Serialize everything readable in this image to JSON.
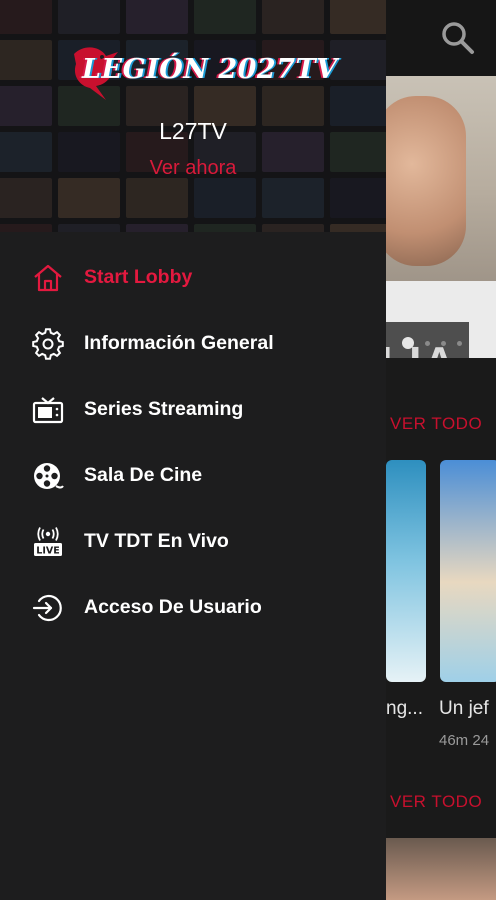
{
  "drawer": {
    "logo_text": "LEGIÓN 2027TV",
    "app_name": "L27TV",
    "watch_now": "Ver ahora",
    "items": [
      {
        "label": "Start Lobby",
        "icon": "home-icon",
        "active": true
      },
      {
        "label": "Información General",
        "icon": "gear-icon",
        "active": false
      },
      {
        "label": "Series Streaming",
        "icon": "tv-icon",
        "active": false
      },
      {
        "label": "Sala De Cine",
        "icon": "film-reel-icon",
        "active": false
      },
      {
        "label": "TV TDT En Vivo",
        "icon": "live-broadcast-icon",
        "active": false
      },
      {
        "label": "Acceso De Usuario",
        "icon": "login-icon",
        "active": false
      }
    ]
  },
  "background": {
    "hero_title_partial": "ILIA",
    "carousel_dots": 4,
    "carousel_active_index": 0,
    "section_links": [
      "VER TODO",
      "VER TODO"
    ],
    "posters": [
      {
        "title": "ng...",
        "meta": ""
      },
      {
        "title": "Un jef",
        "meta": "46m 24"
      }
    ]
  },
  "colors": {
    "accent": "#e3193f",
    "drawer_bg": "#1d1d1e",
    "app_bg": "#1a1a1a"
  }
}
